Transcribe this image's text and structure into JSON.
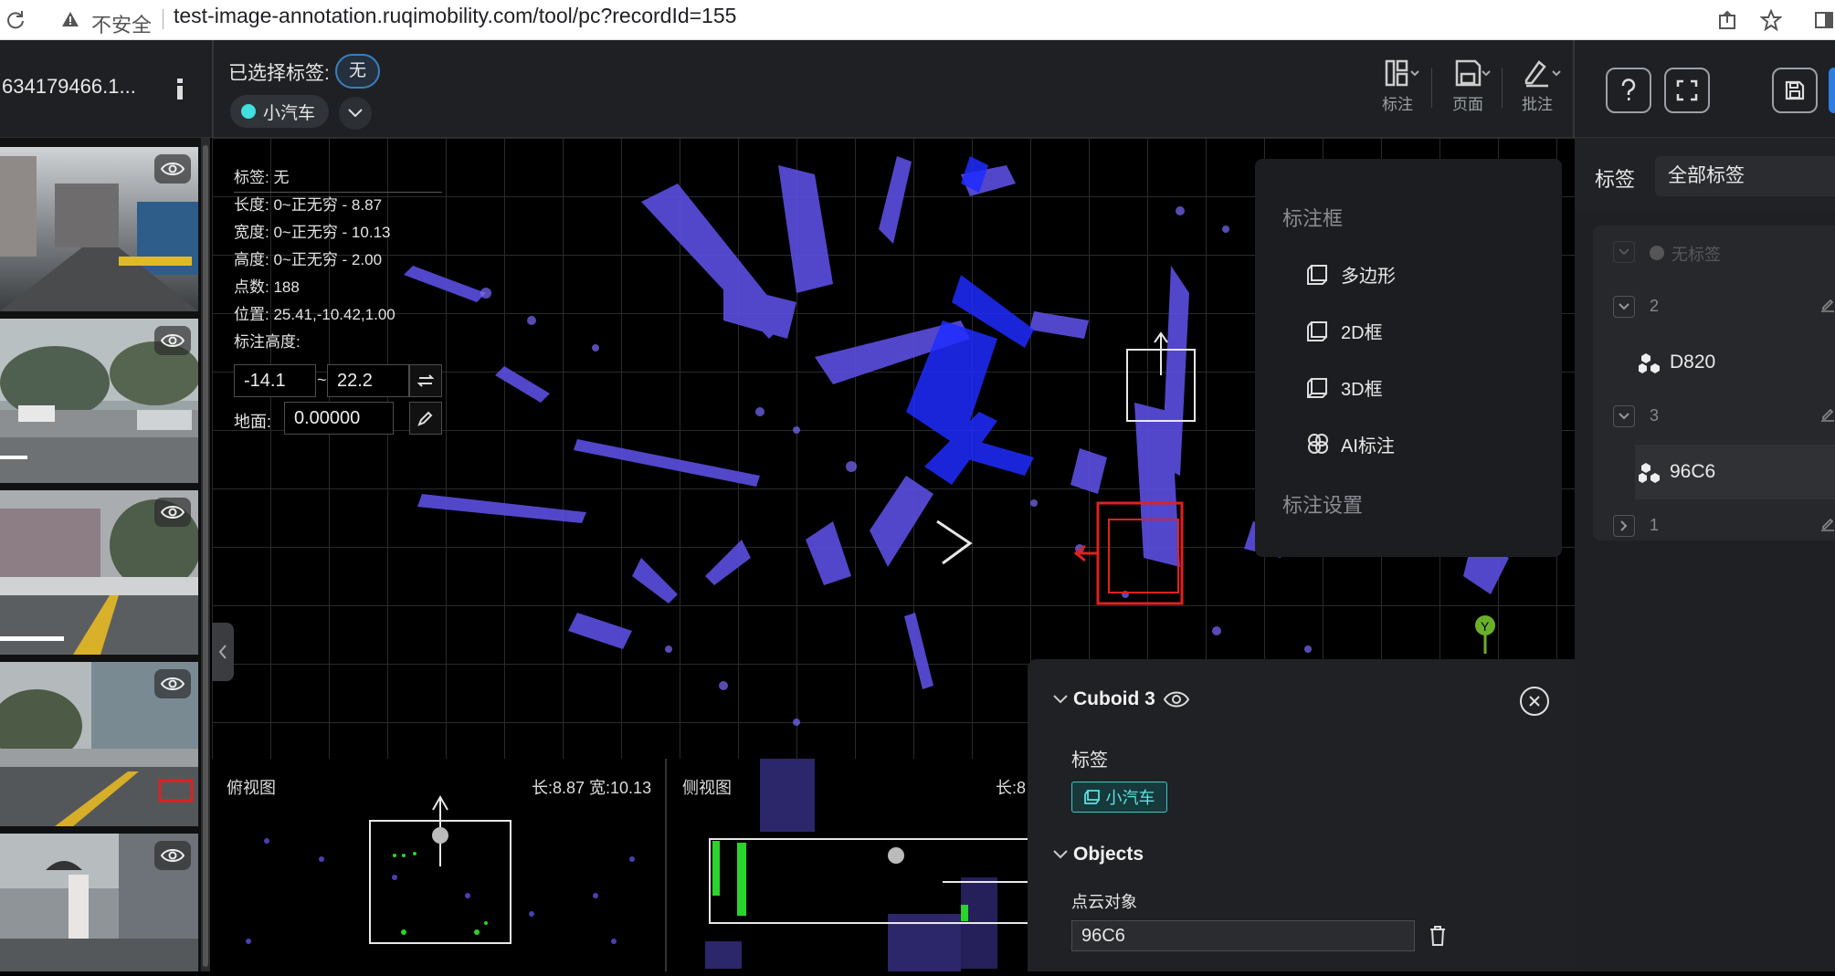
{
  "browser": {
    "security_label": "不安全",
    "url": "test-image-annotation.ruqimobility.com/tool/pc?recordId=155"
  },
  "header": {
    "record_id": "634179466.1...",
    "selected_label_title": "已选择标签:",
    "selected_label_value": "无",
    "active_class": "小汽车",
    "tools": [
      {
        "label": "标注",
        "icon": "annotate-icon"
      },
      {
        "label": "页面",
        "icon": "page-save-icon"
      },
      {
        "label": "批注",
        "icon": "comment-pen-icon"
      }
    ]
  },
  "camera_thumbnails": [
    {
      "id": "cam1"
    },
    {
      "id": "cam2"
    },
    {
      "id": "cam3"
    },
    {
      "id": "cam4"
    },
    {
      "id": "cam5"
    }
  ],
  "info_panel": {
    "label": "标签: 无",
    "length": "长度: 0~正无穷 - 8.87",
    "width": "宽度: 0~正无穷 - 10.13",
    "height": "高度: 0~正无穷 - 2.00",
    "points": "点数: 188",
    "position": "位置: 25.41,-10.42,1.00",
    "annot_height_label": "标注高度:",
    "height_min": "-14.1",
    "height_sep": "~",
    "height_max": "22.2",
    "ground_label": "地面:",
    "ground_value": "0.00000"
  },
  "annotate_menu": {
    "section_title": "标注框",
    "items": [
      {
        "label": "多边形",
        "icon": "polygon-icon"
      },
      {
        "label": "2D框",
        "icon": "box-2d-icon"
      },
      {
        "label": "3D框",
        "icon": "box-3d-icon"
      },
      {
        "label": "AI标注",
        "icon": "ai-icon"
      }
    ],
    "settings": "标注设置"
  },
  "right_panel": {
    "title": "标签",
    "filter": "全部标签",
    "groups": [
      {
        "name": "无标签"
      },
      {
        "name": "2",
        "objects": [
          "D820"
        ]
      },
      {
        "name": "3",
        "objects": [
          "96C6"
        ]
      },
      {
        "name": "1"
      }
    ]
  },
  "bottom_views": {
    "top_view_title": "俯视图",
    "top_view_stats": "长:8.87 宽:10.13",
    "side_view_title": "侧视图",
    "side_view_stats": "长:8"
  },
  "properties": {
    "title": "Cuboid 3",
    "label_title": "标签",
    "label_value": "小汽车",
    "objects_title": "Objects",
    "point_cloud_label": "点云对象",
    "object_value": "96C6"
  },
  "colors": {
    "accent": "#2f7de1",
    "point_cloud": "#6a5cff",
    "selected_box": "#e02020",
    "label_chip": "#3ec7c7"
  }
}
